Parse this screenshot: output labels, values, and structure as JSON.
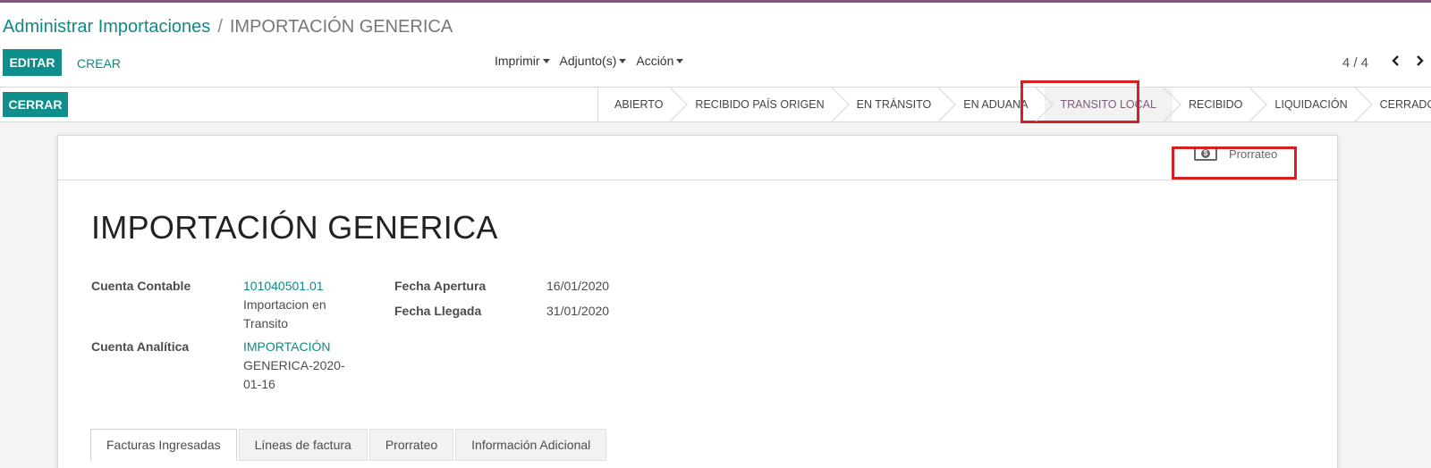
{
  "breadcrumb": {
    "parent": "Administrar Importaciones",
    "separator": "/",
    "current": "IMPORTACIÓN GENERICA"
  },
  "buttons": {
    "edit": "EDITAR",
    "create": "CREAR",
    "close": "CERRAR"
  },
  "menus": {
    "print": "Imprimir",
    "attachments": "Adjunto(s)",
    "action": "Acción"
  },
  "pager": {
    "value": "4 / 4",
    "prev_icon": "chevron-left-icon",
    "next_icon": "chevron-right-icon"
  },
  "statusbar": {
    "stages": [
      "ABIERTO",
      "RECIBIDO PAÍS ORIGEN",
      "EN TRÁNSITO",
      "EN ADUANA",
      "TRANSITO LOCAL",
      "RECIBIDO",
      "LIQUIDACIÓN",
      "CERRADO"
    ],
    "active": "TRANSITO LOCAL"
  },
  "smart_button": {
    "label": "Prorrateo",
    "icon": "money-icon"
  },
  "record": {
    "title": "IMPORTACIÓN GENERICA",
    "fields": {
      "cuenta_contable_label": "Cuenta Contable",
      "cuenta_contable_code": "101040501.01",
      "cuenta_contable_name_1": "Importacion en",
      "cuenta_contable_name_2": "Transito",
      "cuenta_analitica_label": "Cuenta Analítica",
      "cuenta_analitica_1": "IMPORTACIÓN",
      "cuenta_analitica_2": "GENERICA-2020-",
      "cuenta_analitica_3": "01-16",
      "fecha_apertura_label": "Fecha Apertura",
      "fecha_apertura": "16/01/2020",
      "fecha_llegada_label": "Fecha Llegada",
      "fecha_llegada": "31/01/2020"
    }
  },
  "tabs": [
    "Facturas Ingresadas",
    "Líneas de factura",
    "Prorrateo",
    "Información Adicional"
  ],
  "colors": {
    "accent": "#0f8f8c",
    "brand": "#7c5a7a",
    "highlight": "#d42020"
  }
}
